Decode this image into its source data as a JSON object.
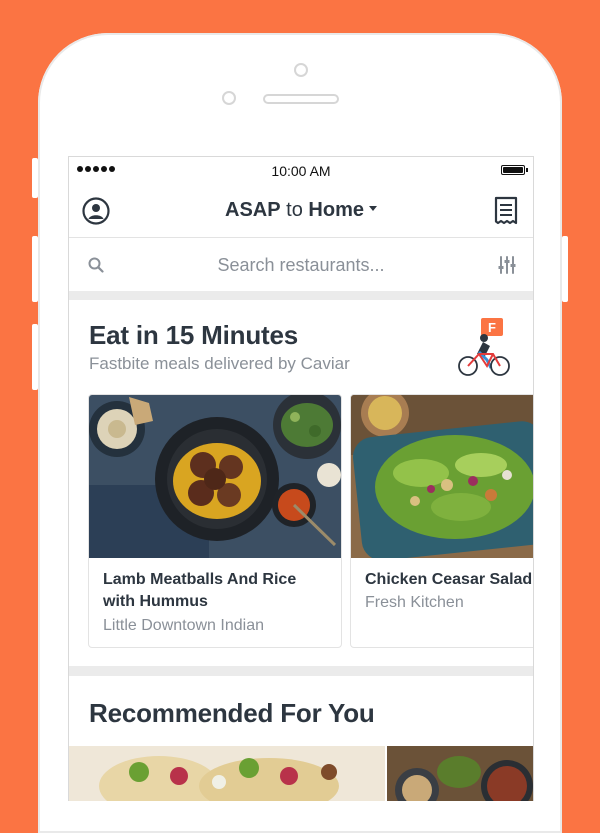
{
  "status_bar": {
    "time": "10:00 AM"
  },
  "header": {
    "asap": "ASAP",
    "to": "to",
    "destination": "Home"
  },
  "search": {
    "placeholder": "Search restaurants..."
  },
  "fast_section": {
    "title": "Eat in 15 Minutes",
    "subtitle": "Fastbite meals delivered by Caviar",
    "badge_letter": "F"
  },
  "cards": [
    {
      "name": "Lamb Meatballs And Rice\nwith Hummus",
      "restaurant": "Little Downtown Indian"
    },
    {
      "name": "Chicken Ceasar Salad",
      "restaurant": "Fresh Kitchen"
    }
  ],
  "recommended": {
    "title": "Recommended For You"
  },
  "colors": {
    "brand": "#fb7443",
    "text": "#2d3640",
    "muted": "#8a9098"
  }
}
